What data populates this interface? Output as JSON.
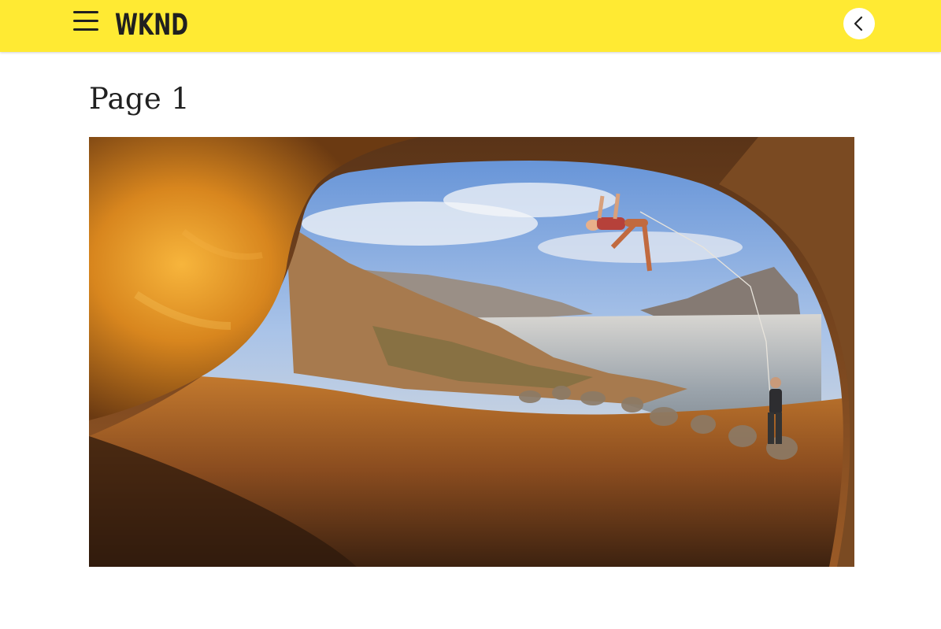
{
  "header": {
    "brand_name": "WKND",
    "menu_icon": "hamburger-menu-icon",
    "back_icon": "chevron-left-icon",
    "background_color": "#ffea33"
  },
  "main": {
    "page_title": "Page 1",
    "hero_image": {
      "subject": "climber-in-sea-cave-at-sunset"
    }
  },
  "colors": {
    "text": "#202020",
    "accent": "#ffea33",
    "page_background": "#ffffff"
  }
}
